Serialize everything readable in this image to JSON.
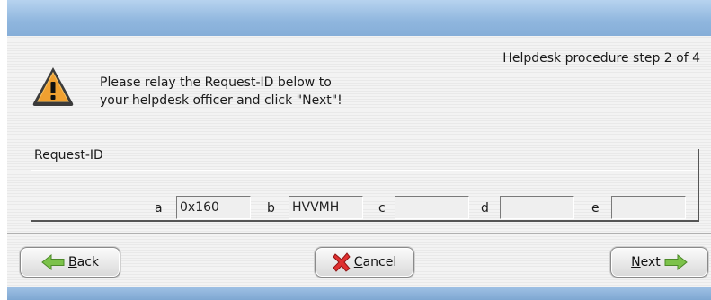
{
  "dialog": {
    "step_text": "Helpdesk procedure step 2 of 4",
    "message_line1": "Please relay the Request-ID below to",
    "message_line2": "your helpdesk officer and click \"Next\"!"
  },
  "request_id": {
    "group_label": "Request-ID",
    "fields": [
      {
        "label": "a",
        "value": "0x160"
      },
      {
        "label": "b",
        "value": "HVVMH"
      },
      {
        "label": "c",
        "value": ""
      },
      {
        "label": "d",
        "value": ""
      },
      {
        "label": "e",
        "value": ""
      }
    ]
  },
  "buttons": {
    "back": {
      "mnemonic": "B",
      "rest": "ack"
    },
    "cancel": {
      "mnemonic": "C",
      "rest": "ancel"
    },
    "next": {
      "mnemonic": "N",
      "rest": "ext"
    }
  },
  "icons": {
    "warning": "warning-icon",
    "back": "arrow-left-icon",
    "cancel": "cancel-x-icon",
    "next": "arrow-right-icon"
  },
  "colors": {
    "titlebar": "#8fb6de",
    "warning_fill": "#f0a030",
    "arrow_green": "#7cc24a",
    "cancel_red": "#e03030"
  }
}
